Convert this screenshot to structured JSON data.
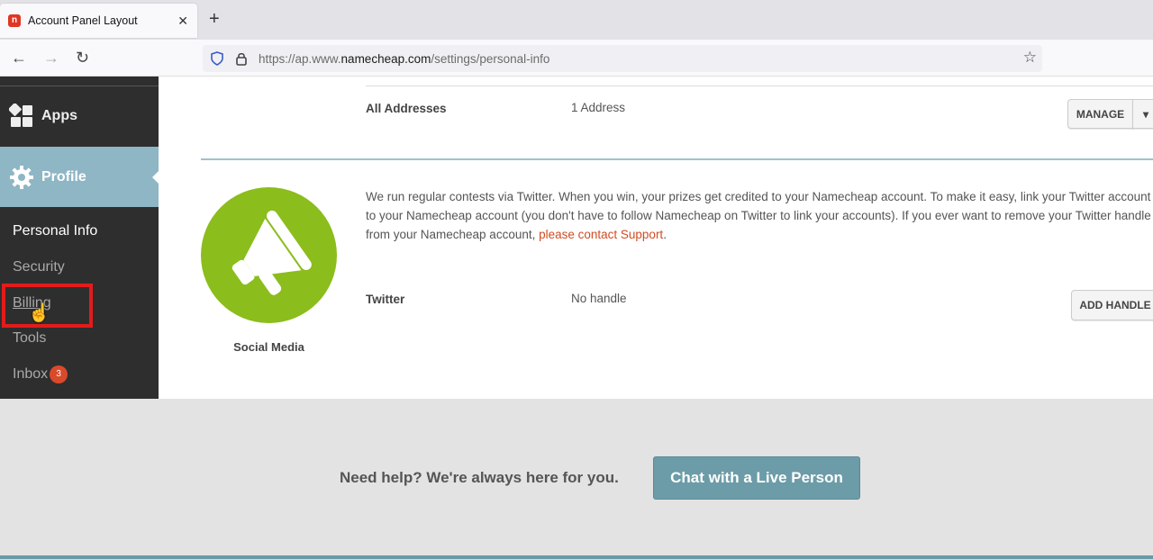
{
  "browser": {
    "tab_title": "Account Panel Layout",
    "tab_close": "✕",
    "new_tab": "+",
    "url_prefix": "https://ap.www.",
    "url_domain": "namecheap.com",
    "url_path": "/settings/personal-info",
    "back": "←",
    "forward": "→",
    "reload": "↻"
  },
  "sidebar": {
    "apps_label": "Apps",
    "profile_label": "Profile",
    "items": [
      {
        "label": "Personal Info"
      },
      {
        "label": "Security"
      },
      {
        "label": "Billing"
      },
      {
        "label": "Tools"
      },
      {
        "label": "Inbox"
      }
    ],
    "inbox_badge": "3"
  },
  "addresses": {
    "label": "All Addresses",
    "value": "1 Address",
    "manage_label": "MANAGE",
    "dropdown_icon": "▾"
  },
  "social": {
    "section_label": "Social Media",
    "description": "We run regular contests via Twitter. When you win, your prizes get credited to your Namecheap account. To make it easy, link your Twitter account to your Namecheap account (you don't have to follow Namecheap on Twitter to link your accounts). If you ever want to remove your Twitter handle from your Namecheap account, ",
    "support_link": "please contact Support",
    "description_end": ".",
    "twitter_label": "Twitter",
    "twitter_value": "No handle",
    "add_handle_label": "ADD HANDLE"
  },
  "footer": {
    "help_text": "Need help? We're always here for you.",
    "chat_label": "Chat with a Live Person"
  },
  "colors": {
    "accent": "#8eb6c5",
    "social_green": "#8bbd1c",
    "link": "#d14b22",
    "badge": "#d94a2b",
    "highlight": "#e31b1b"
  }
}
